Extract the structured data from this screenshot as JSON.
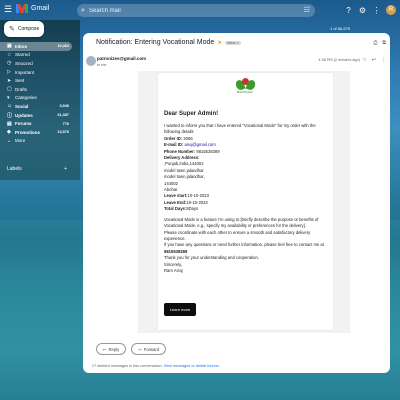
{
  "header": {
    "app_name": "Gmail",
    "search_placeholder": "Search mail",
    "avatar_letter": "R"
  },
  "sidebar": {
    "compose_label": "Compose",
    "items": [
      {
        "label": "Inbox",
        "count": "10,464",
        "icon": "inbox-icon",
        "active": true
      },
      {
        "label": "Starred",
        "count": "",
        "icon": "star-icon"
      },
      {
        "label": "Snoozed",
        "count": "",
        "icon": "clock-icon"
      },
      {
        "label": "Important",
        "count": "",
        "icon": "important-icon"
      },
      {
        "label": "Sent",
        "count": "",
        "icon": "send-icon"
      },
      {
        "label": "Drafts",
        "count": "",
        "icon": "draft-icon"
      },
      {
        "label": "Categories",
        "count": "",
        "icon": "category-icon"
      },
      {
        "label": "Social",
        "count": "3,946",
        "icon": "people-icon"
      },
      {
        "label": "Updates",
        "count": "41,387",
        "icon": "info-icon"
      },
      {
        "label": "Forums",
        "count": "776",
        "icon": "forum-icon"
      },
      {
        "label": "Promotions",
        "count": "13,976",
        "icon": "tag-icon"
      },
      {
        "label": "More",
        "count": "",
        "icon": "chevron-down-icon"
      }
    ],
    "labels_heading": "Labels",
    "labels_add": "+"
  },
  "email": {
    "page_count": "1 of 56,579",
    "subject": "Notification: Entering Vocational Mode",
    "tag": "Inbox ×",
    "sender": "patronizes@gmail.com",
    "to": "to me",
    "date": "4:38 PM (2 minutes ago)",
    "brand_name": "Brand Organic",
    "greeting": "Dear Super Admin!",
    "intro": "I wanted to inform you that I have entered \"Vocational Mode\" for my order with the following details",
    "order_id_label": "Order ID:",
    "order_id": "2066",
    "email_label": "E-mail ID:",
    "email_value": "anuj@gmail.com",
    "phone_label": "Phone Number:",
    "phone_value": "9815538389",
    "delivery_label": "Delivery Address:",
    "address_lines": [
      ",Punjab,India,144002",
      "model town jalandhar",
      "model town jalandhar,",
      "144002",
      "Abohar"
    ],
    "leave_start_label": "Leave start:",
    "leave_start": "10-10-2023",
    "leave_end_label": "Leave End:",
    "leave_end": "19-10-2023",
    "total_days_label": "Total Days:",
    "total_days": "9Days",
    "para1": "Vocational Mode is a feature I'm using to [briefly describe the purpose or benefits of Vocational Mode, e.g., specify my availability or preferences for the delivery].",
    "para2": "Please coordinate with each other to ensure a smooth and satisfactory delivery experience.",
    "para3_prefix": "If you have any questions or need further information, please feel free to contact me at",
    "contact_phone": "9815538389",
    "thanks": "Thank you for your understanding and cooperation.",
    "signoff": "Sincerely,",
    "name": "Ram Arraj",
    "learn_more": "Learn more",
    "reply": "Reply",
    "forward": "Forward",
    "footnote_prefix": "27 deleted messages in this conversation.",
    "footnote_link": "View messages or delete forever."
  }
}
